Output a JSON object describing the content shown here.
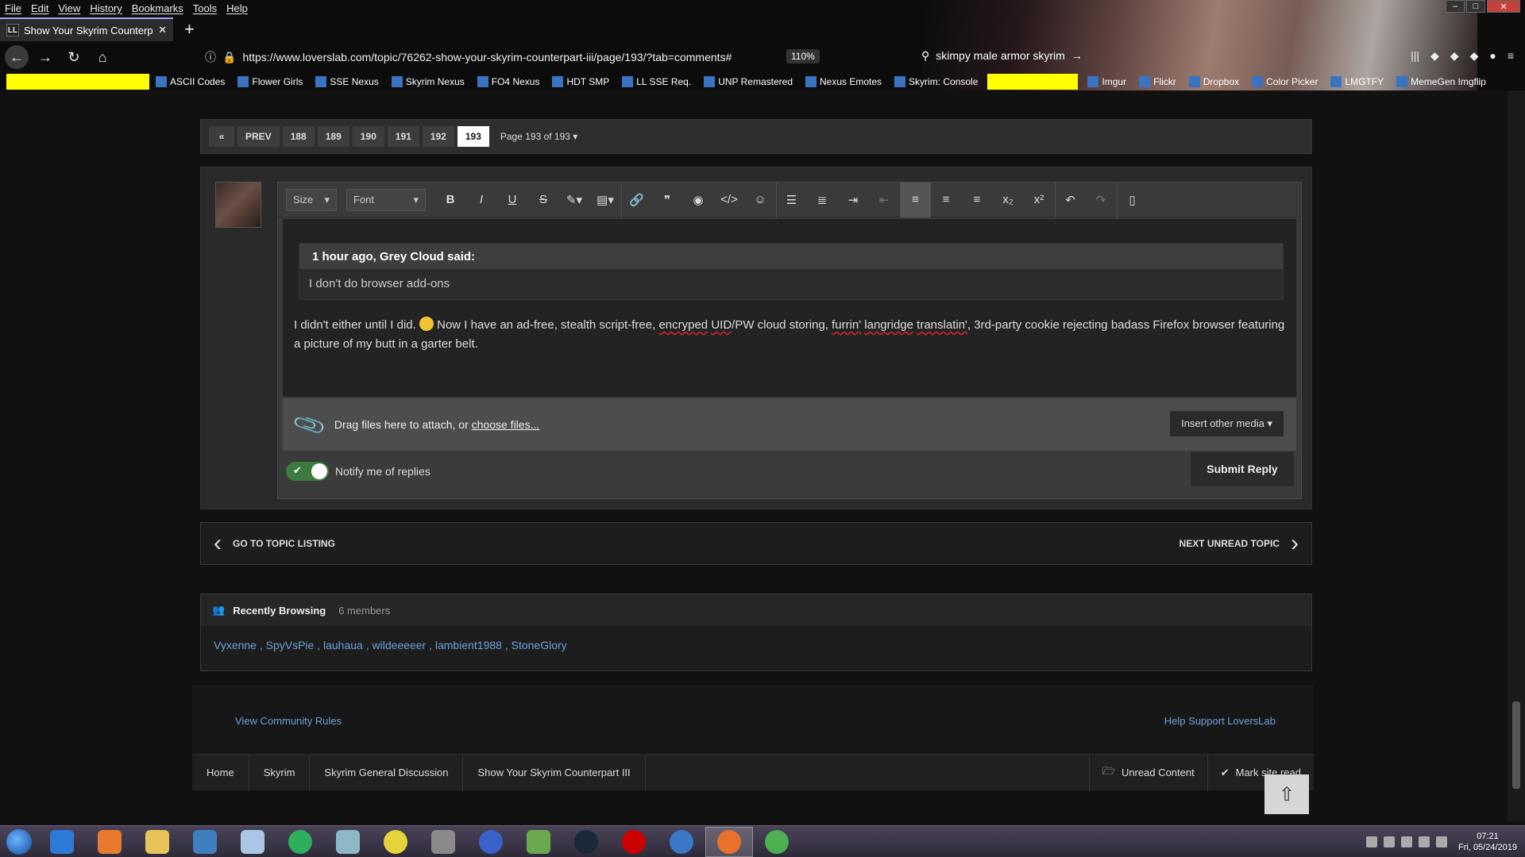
{
  "browser": {
    "menu": [
      "File",
      "Edit",
      "View",
      "History",
      "Bookmarks",
      "Tools",
      "Help"
    ],
    "tab_title": "Show Your Skyrim Counterpart",
    "tab_favicon": "LL",
    "url": "https://www.loverslab.com/topic/76262-show-your-skyrim-counterpart-iii/page/193/?tab=comments#",
    "zoom": "110%",
    "search": "skimpy male armor skyrim",
    "bookmarks": [
      "ASCII Codes",
      "Flower Girls",
      "SSE Nexus",
      "Skyrim Nexus",
      "FO4 Nexus",
      "HDT SMP",
      "LL SSE Req.",
      "UNP Remastered",
      "Nexus Emotes",
      "Skyrim: Console",
      "Imgur",
      "Flickr",
      "Dropbox",
      "Color Picker",
      "LMGTFY",
      "MemeGen Imgflip"
    ]
  },
  "pagination": {
    "first": "«",
    "prev": "PREV",
    "pages": [
      "188",
      "189",
      "190",
      "191",
      "192",
      "193"
    ],
    "current": "193",
    "info": "Page 193 of 193"
  },
  "editor": {
    "size_label": "Size",
    "font_label": "Font",
    "quote_header": "1 hour ago, Grey Cloud said:",
    "quote_body": "I don't do browser add-ons",
    "text_before": "I didn't either until I did. ",
    "text_mid": " Now I have an ad-free, stealth script-free, ",
    "text_w1": "encryped",
    "text_w2": "UID",
    "text_mid2": "/PW cloud storing, ",
    "text_w3": "furrin'",
    "text_w4": "langridge",
    "text_w5": "translatin'",
    "text_end": ", 3rd-party cookie rejecting badass Firefox browser featuring a picture of my butt in a garter belt.",
    "attach_text": "Drag files here to attach, or",
    "attach_link": "choose files...",
    "insert_media": "Insert other media ▾",
    "notify_label": "Notify me of replies",
    "submit_label": "Submit Reply"
  },
  "topicnav": {
    "prev_label": "GO TO TOPIC LISTING",
    "next_label": "NEXT UNREAD TOPIC"
  },
  "recent": {
    "title": "Recently Browsing",
    "count": "6 members",
    "members": "Vyxenne , SpyVsPie , lauhaua , wildeeeeer , lambient1988 , StoneGlory"
  },
  "footer": {
    "rules": "View Community Rules",
    "support": "Help Support LoversLab"
  },
  "breadcrumbs": [
    "Home",
    "Skyrim",
    "Skyrim General Discussion",
    "Show Your Skyrim Counterpart III"
  ],
  "breadcrumb_actions": {
    "unread": "Unread Content",
    "mark_read": "Mark site read"
  },
  "taskbar": {
    "time": "07:21",
    "date": "Fri, 05/24/2019"
  }
}
